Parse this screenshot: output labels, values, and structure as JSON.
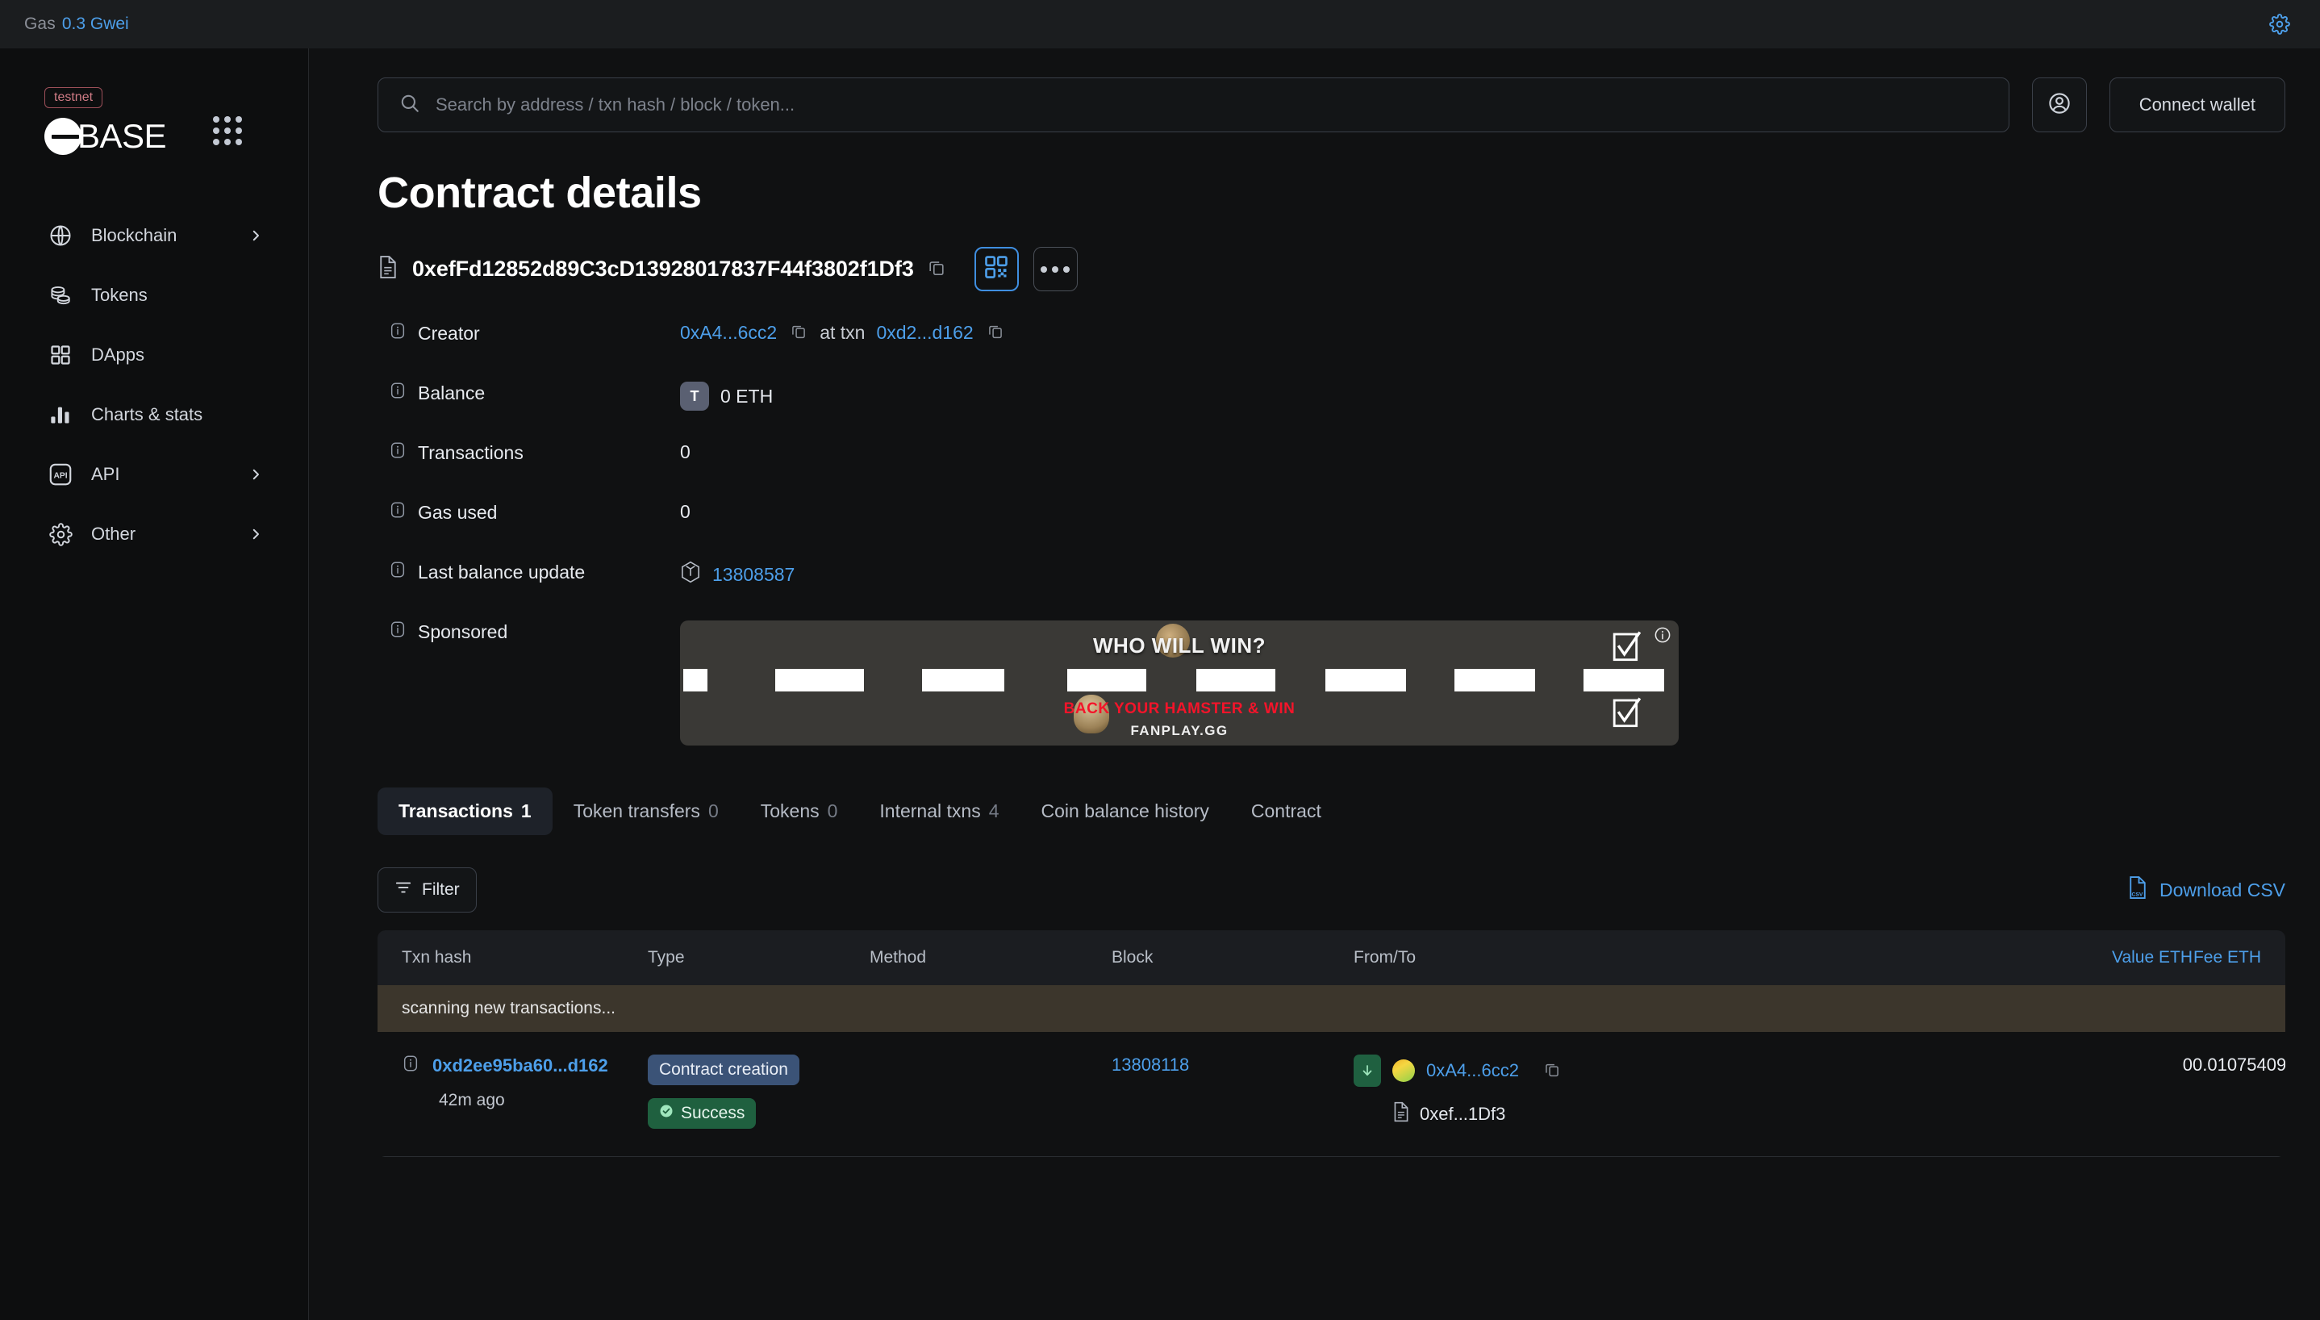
{
  "topbar": {
    "gas_label": "Gas",
    "gas_value": "0.3 Gwei",
    "settings_icon": "gear-icon"
  },
  "sidebar": {
    "network_badge": "testnet",
    "brand": "BASE",
    "apps_icon": "apps-grid-icon",
    "items": [
      {
        "label": "Blockchain",
        "icon": "globe-icon",
        "has_chevron": true
      },
      {
        "label": "Tokens",
        "icon": "coins-icon",
        "has_chevron": false
      },
      {
        "label": "DApps",
        "icon": "grid-squares-icon",
        "has_chevron": false
      },
      {
        "label": "Charts & stats",
        "icon": "bar-chart-icon",
        "has_chevron": false
      },
      {
        "label": "API",
        "icon": "api-icon",
        "has_chevron": true
      },
      {
        "label": "Other",
        "icon": "gear-icon",
        "has_chevron": true
      }
    ]
  },
  "search": {
    "placeholder": "Search by address / txn hash / block / token...",
    "icon": "search-icon"
  },
  "header": {
    "profile_icon": "user-circle-icon",
    "connect_wallet": "Connect wallet"
  },
  "page": {
    "title": "Contract details",
    "address": "0xefFd12852d89C3cD13928017837F44f3802f1Df3",
    "address_icon": "contract-file-icon",
    "copy_icon": "copy-icon",
    "qr_icon": "qr-code-icon",
    "more_icon": "more-dots-icon"
  },
  "details": {
    "creator": {
      "label": "Creator",
      "address": "0xA4...6cc2",
      "at_txn_text": "at txn",
      "txn": "0xd2...d162"
    },
    "balance": {
      "label": "Balance",
      "token_symbol": "T",
      "value": "0 ETH"
    },
    "transactions": {
      "label": "Transactions",
      "value": "0"
    },
    "gas_used": {
      "label": "Gas used",
      "value": "0"
    },
    "last_balance_update": {
      "label": "Last balance update",
      "value": "13808587",
      "icon": "block-cube-icon"
    },
    "sponsored": {
      "label": "Sponsored"
    }
  },
  "banner": {
    "title": "WHO WILL WIN?",
    "subtitle": "BACK YOUR HAMSTER & WIN",
    "brand": "FANPLAY.GG",
    "info_icon": "info-circle-icon"
  },
  "tabs": [
    {
      "label": "Transactions",
      "count": "1",
      "active": true
    },
    {
      "label": "Token transfers",
      "count": "0",
      "active": false
    },
    {
      "label": "Tokens",
      "count": "0",
      "active": false
    },
    {
      "label": "Internal txns",
      "count": "4",
      "active": false
    },
    {
      "label": "Coin balance history",
      "count": "",
      "active": false
    },
    {
      "label": "Contract",
      "count": "",
      "active": false
    }
  ],
  "toolbar": {
    "filter_label": "Filter",
    "filter_icon": "filter-icon",
    "download_label": "Download CSV",
    "download_icon": "csv-file-icon"
  },
  "table": {
    "columns": [
      "Txn hash",
      "Type",
      "Method",
      "Block",
      "From/To",
      "Value ETH",
      "Fee ETH"
    ],
    "status_message": "scanning new transactions...",
    "rows": [
      {
        "info_icon": "info-icon",
        "txn_hash": "0xd2ee95ba60...d162",
        "time_ago": "42m ago",
        "type": "Contract creation",
        "status": "Success",
        "method": "",
        "block": "13808118",
        "from_address": "0xA4...6cc2",
        "to_address": "0xef...1Df3",
        "direction_icon": "arrow-down-in-icon",
        "value": "0",
        "fee": "0.01075409"
      }
    ]
  },
  "colors": {
    "accent_blue": "#4d9fea",
    "qr_border": "#3f8ee0",
    "success_green": "#1f603f",
    "type_badge": "#3b5377",
    "scan_bar": "#3c362c",
    "testnet_red": "#cf7b85"
  }
}
